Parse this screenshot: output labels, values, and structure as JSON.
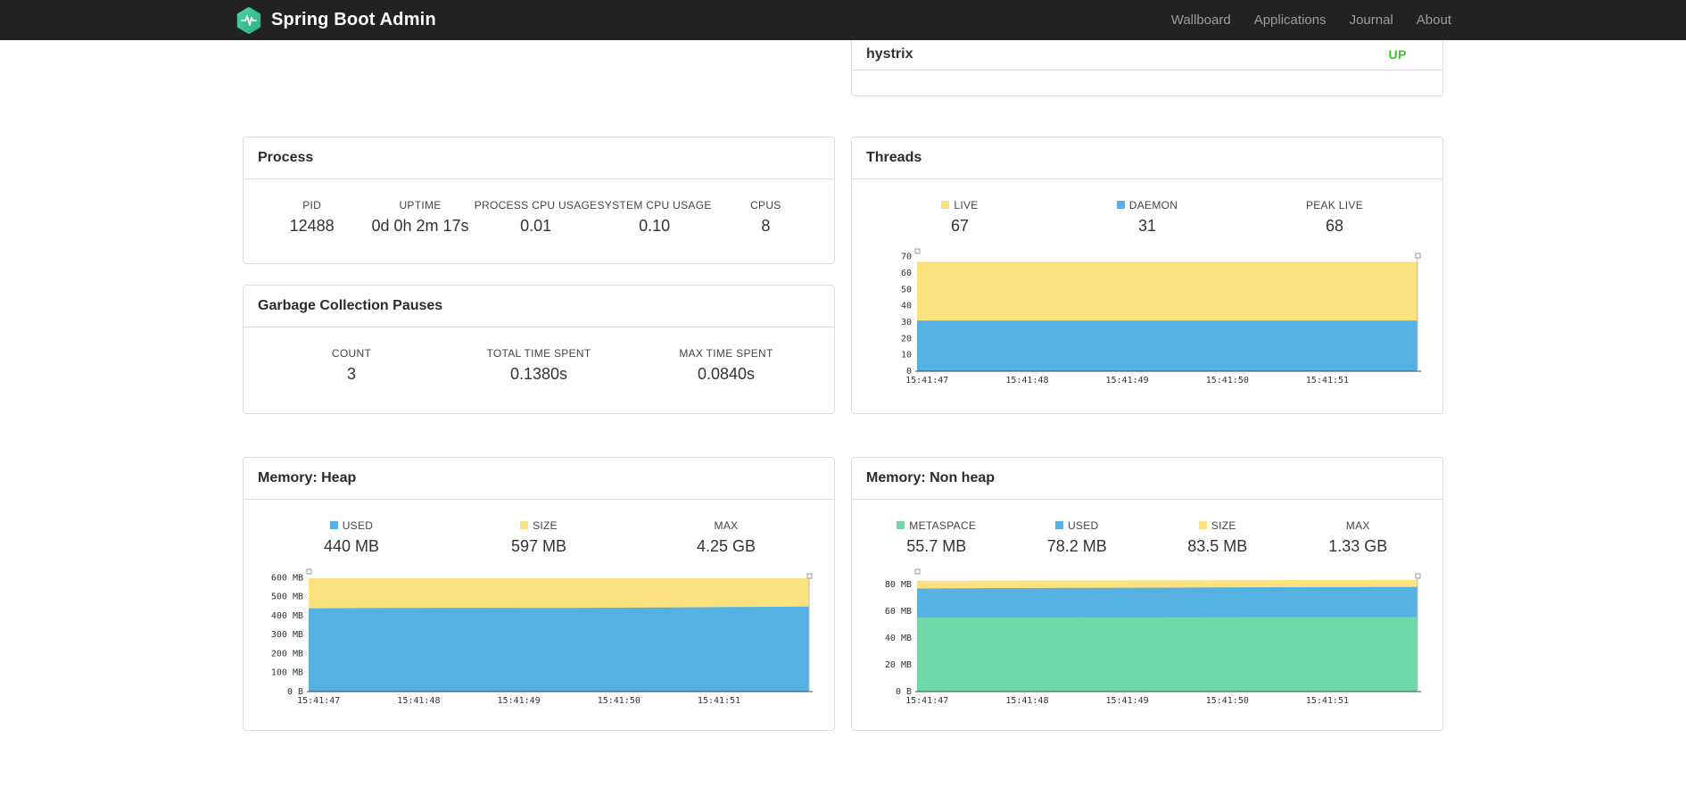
{
  "colors": {
    "navbar-bg": "#222222",
    "navlink": "#9d9d9d",
    "accent": "#4bd2a0",
    "accent-dark": "#2cb183",
    "status-up": "#3ec12e",
    "chart-yellow": "#fce27e",
    "chart-blue": "#55b1e2",
    "chart-green": "#6ed8a6"
  },
  "navbar": {
    "brand": "Spring Boot Admin",
    "links": [
      {
        "label": "Wallboard"
      },
      {
        "label": "Applications"
      },
      {
        "label": "Journal"
      },
      {
        "label": "About"
      }
    ]
  },
  "application_row": {
    "name": "hystrix",
    "status": "UP"
  },
  "panels": {
    "process": {
      "title": "Process",
      "metrics": [
        {
          "label": "PID",
          "value": "12488"
        },
        {
          "label": "UPTIME",
          "value": "0d 0h 2m 17s"
        },
        {
          "label": "PROCESS CPU USAGE",
          "value": "0.01"
        },
        {
          "label": "SYSTEM CPU USAGE",
          "value": "0.10"
        },
        {
          "label": "CPUS",
          "value": "8"
        }
      ]
    },
    "gc": {
      "title": "Garbage Collection Pauses",
      "metrics": [
        {
          "label": "COUNT",
          "value": "3"
        },
        {
          "label": "TOTAL TIME SPENT",
          "value": "0.1380s"
        },
        {
          "label": "MAX TIME SPENT",
          "value": "0.0840s"
        }
      ]
    },
    "threads": {
      "title": "Threads",
      "metrics": [
        {
          "label": "LIVE",
          "value": "67",
          "swatch": "#fce27e"
        },
        {
          "label": "DAEMON",
          "value": "31",
          "swatch": "#55b1e2"
        },
        {
          "label": "PEAK LIVE",
          "value": "68"
        }
      ]
    },
    "heap": {
      "title": "Memory: Heap",
      "metrics": [
        {
          "label": "USED",
          "value": "440 MB",
          "swatch": "#55b1e2"
        },
        {
          "label": "SIZE",
          "value": "597 MB",
          "swatch": "#fce27e"
        },
        {
          "label": "MAX",
          "value": "4.25 GB"
        }
      ]
    },
    "nonheap": {
      "title": "Memory: Non heap",
      "metrics": [
        {
          "label": "METASPACE",
          "value": "55.7 MB",
          "swatch": "#6ed8a6"
        },
        {
          "label": "USED",
          "value": "78.2 MB",
          "swatch": "#55b1e2"
        },
        {
          "label": "SIZE",
          "value": "83.5 MB",
          "swatch": "#fce27e"
        },
        {
          "label": "MAX",
          "value": "1.33 GB"
        }
      ]
    }
  },
  "chart_data": [
    {
      "name": "threads",
      "type": "area",
      "title": "Threads",
      "unit": "threads",
      "height": 158,
      "ylim": [
        0,
        72
      ],
      "yticks": [
        {
          "v": 0,
          "label": "0"
        },
        {
          "v": 10,
          "label": "10"
        },
        {
          "v": 20,
          "label": "20"
        },
        {
          "v": 30,
          "label": "30"
        },
        {
          "v": 40,
          "label": "40"
        },
        {
          "v": 50,
          "label": "50"
        },
        {
          "v": 60,
          "label": "60"
        },
        {
          "v": 70,
          "label": "70"
        }
      ],
      "xticks": [
        "15:41:47",
        "15:41:48",
        "15:41:49",
        "15:41:50",
        "15:41:51"
      ],
      "series": [
        {
          "name": "LIVE",
          "color": "#fce27e",
          "values": [
            67,
            67,
            67,
            67,
            67,
            67,
            67
          ]
        },
        {
          "name": "DAEMON",
          "color": "#55b1e2",
          "values": [
            31,
            31,
            31,
            31,
            31,
            31,
            31
          ]
        }
      ],
      "legend_position": "top",
      "grid": false
    },
    {
      "name": "memory-heap",
      "type": "area",
      "title": "Memory: Heap",
      "unit": "MB",
      "height": 158,
      "ylim": [
        0,
        620
      ],
      "yticks": [
        {
          "v": 0,
          "label": "0 B"
        },
        {
          "v": 100,
          "label": "100 MB"
        },
        {
          "v": 200,
          "label": "200 MB"
        },
        {
          "v": 300,
          "label": "300 MB"
        },
        {
          "v": 400,
          "label": "400 MB"
        },
        {
          "v": 500,
          "label": "500 MB"
        },
        {
          "v": 600,
          "label": "600 MB"
        }
      ],
      "xticks": [
        "15:41:47",
        "15:41:48",
        "15:41:49",
        "15:41:50",
        "15:41:51"
      ],
      "series": [
        {
          "name": "SIZE",
          "color": "#fce27e",
          "values": [
            597,
            597,
            597,
            597,
            597,
            597,
            597
          ]
        },
        {
          "name": "USED",
          "color": "#55b1e2",
          "values": [
            438,
            440,
            441,
            440,
            442,
            445,
            447
          ]
        }
      ],
      "legend_position": "top",
      "grid": false
    },
    {
      "name": "memory-nonheap",
      "type": "area",
      "title": "Memory: Non heap",
      "unit": "MB",
      "height": 158,
      "ylim": [
        0,
        88
      ],
      "yticks": [
        {
          "v": 0,
          "label": "0 B"
        },
        {
          "v": 20,
          "label": "20 MB"
        },
        {
          "v": 40,
          "label": "40 MB"
        },
        {
          "v": 60,
          "label": "60 MB"
        },
        {
          "v": 80,
          "label": "80 MB"
        }
      ],
      "xticks": [
        "15:41:47",
        "15:41:48",
        "15:41:49",
        "15:41:50",
        "15:41:51"
      ],
      "series": [
        {
          "name": "SIZE",
          "color": "#fce27e",
          "values": [
            82.8,
            82.9,
            83.1,
            83.2,
            83.3,
            83.4,
            83.5
          ]
        },
        {
          "name": "USED",
          "color": "#55b1e2",
          "values": [
            77.0,
            77.3,
            77.5,
            77.7,
            77.9,
            78.1,
            78.2
          ]
        },
        {
          "name": "METASPACE",
          "color": "#6ed8a6",
          "values": [
            55.3,
            55.4,
            55.5,
            55.5,
            55.6,
            55.7,
            55.7
          ]
        }
      ],
      "legend_position": "top",
      "grid": false
    }
  ]
}
